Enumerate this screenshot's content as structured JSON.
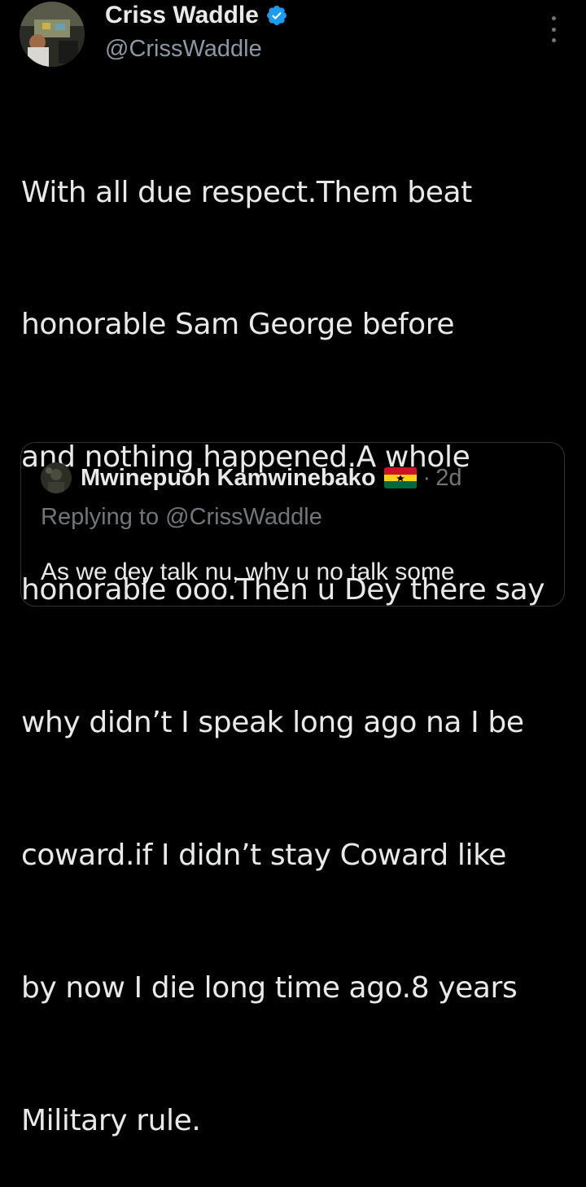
{
  "author": {
    "display_name": "Criss Waddle",
    "handle": "@CrissWaddle",
    "verified_icon": "verified-badge-icon",
    "avatar_icon": "profile-photo"
  },
  "tweet": {
    "lines": [
      "With all due respect.Them beat",
      "honorable Sam George before",
      "and nothing happened.A whole",
      "honorable ooo.Then u Dey there say",
      "why didn’t I speak long ago na I be",
      "coward.if I didn’t stay Coward like",
      "by now I die long time ago.8 years",
      "Military rule."
    ]
  },
  "quoted": {
    "display_name": "Mwinepuoh Kamwinebako",
    "flag_icon": "ghana-flag-emoji",
    "separator": "·",
    "time": "2d",
    "replying_to": "Replying to @CrissWaddle",
    "text": "As we dey talk nu, why u no talk some"
  },
  "menu": {
    "icon": "more-vertical-icon"
  },
  "colors": {
    "background": "#000000",
    "primary_text": "#e7e9ea",
    "secondary_text": "#71767b",
    "verified_blue": "#1d9bf0",
    "border": "#2f3336"
  }
}
